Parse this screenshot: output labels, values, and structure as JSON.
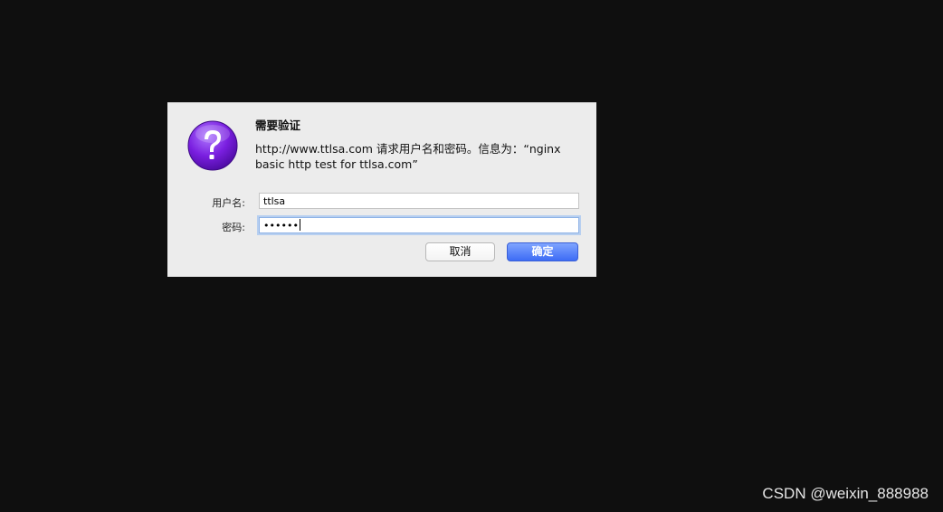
{
  "dialog": {
    "title": "需要验证",
    "message": "http://www.ttlsa.com 请求用户名和密码。信息为：“nginx basic http test for ttlsa.com”",
    "icon": "question-mark-icon",
    "username_label": "用户名:",
    "username_value": "ttlsa",
    "password_label": "密码:",
    "password_masked": "••••••",
    "cancel_label": "取消",
    "ok_label": "确定"
  },
  "colors": {
    "background": "#0f0f0f",
    "dialog_bg": "#ececec",
    "primary_button": "#4a76f7",
    "icon_purple": "#7a1fe0"
  },
  "watermark": "CSDN @weixin_888988"
}
